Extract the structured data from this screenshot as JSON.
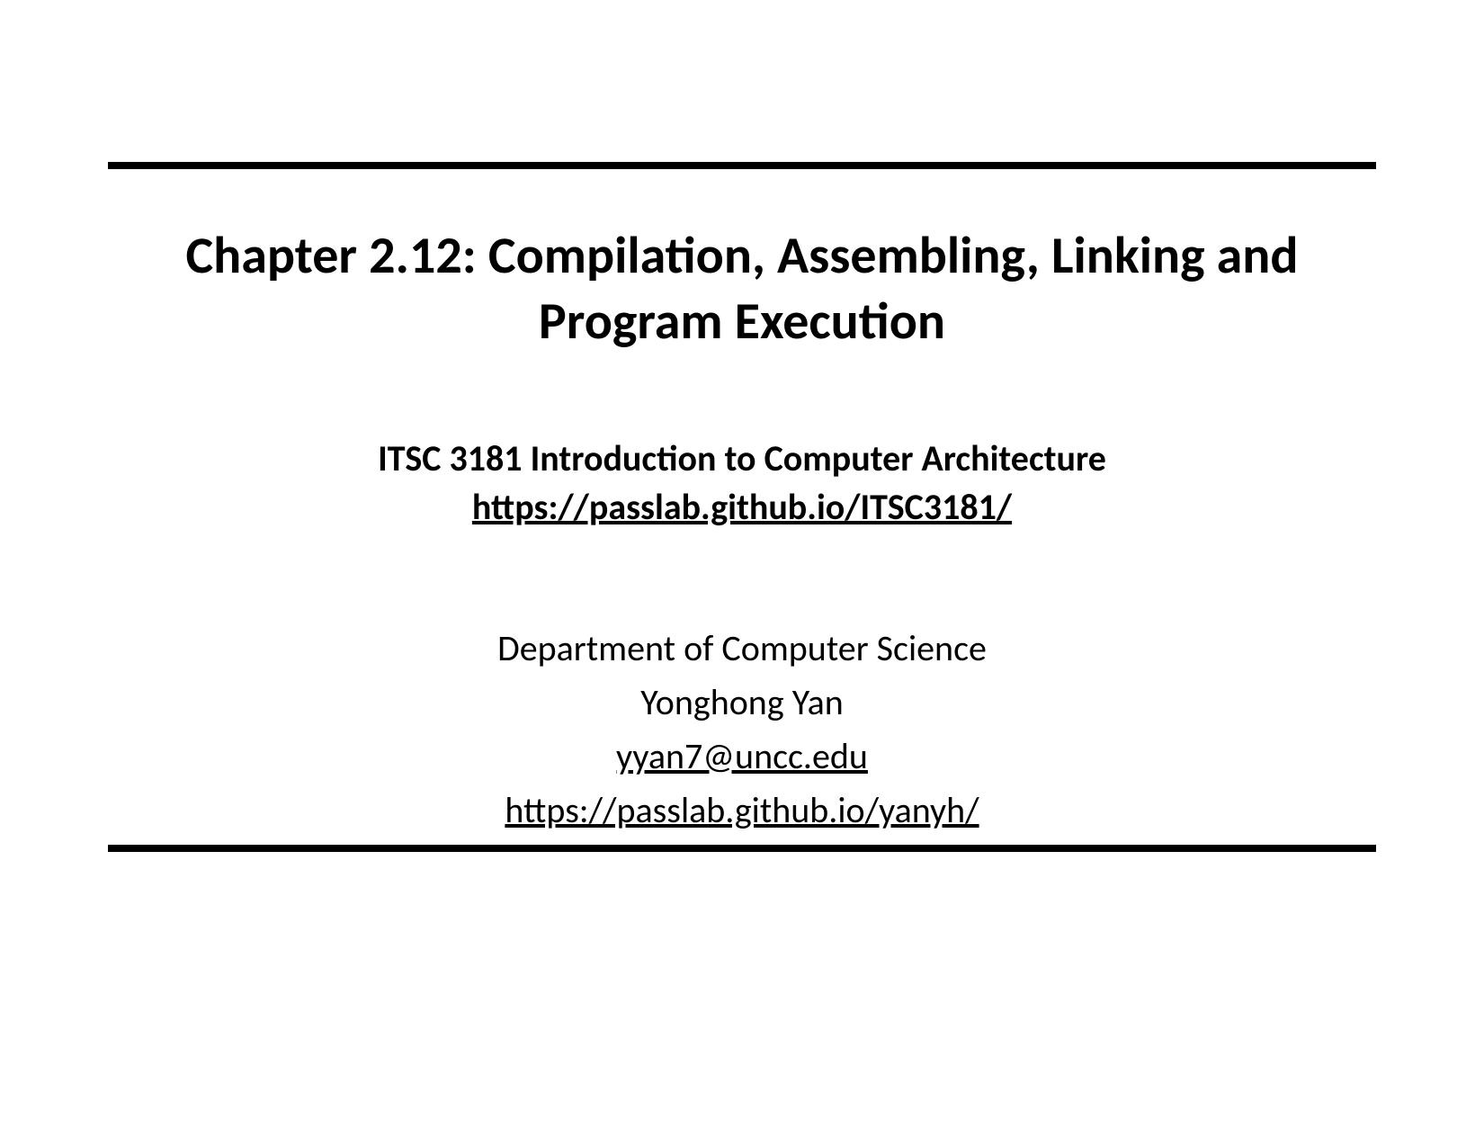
{
  "title": "Chapter 2.12: Compilation, Assembling, Linking and Program Execution",
  "course": {
    "name": "ITSC 3181 Introduction to Computer Architecture",
    "url": "https://passlab.github.io/ITSC3181/"
  },
  "info": {
    "department": "Department of Computer Science",
    "author": "Yonghong Yan",
    "email": "yyan7@uncc.edu",
    "homepage": "https://passlab.github.io/yanyh/"
  }
}
